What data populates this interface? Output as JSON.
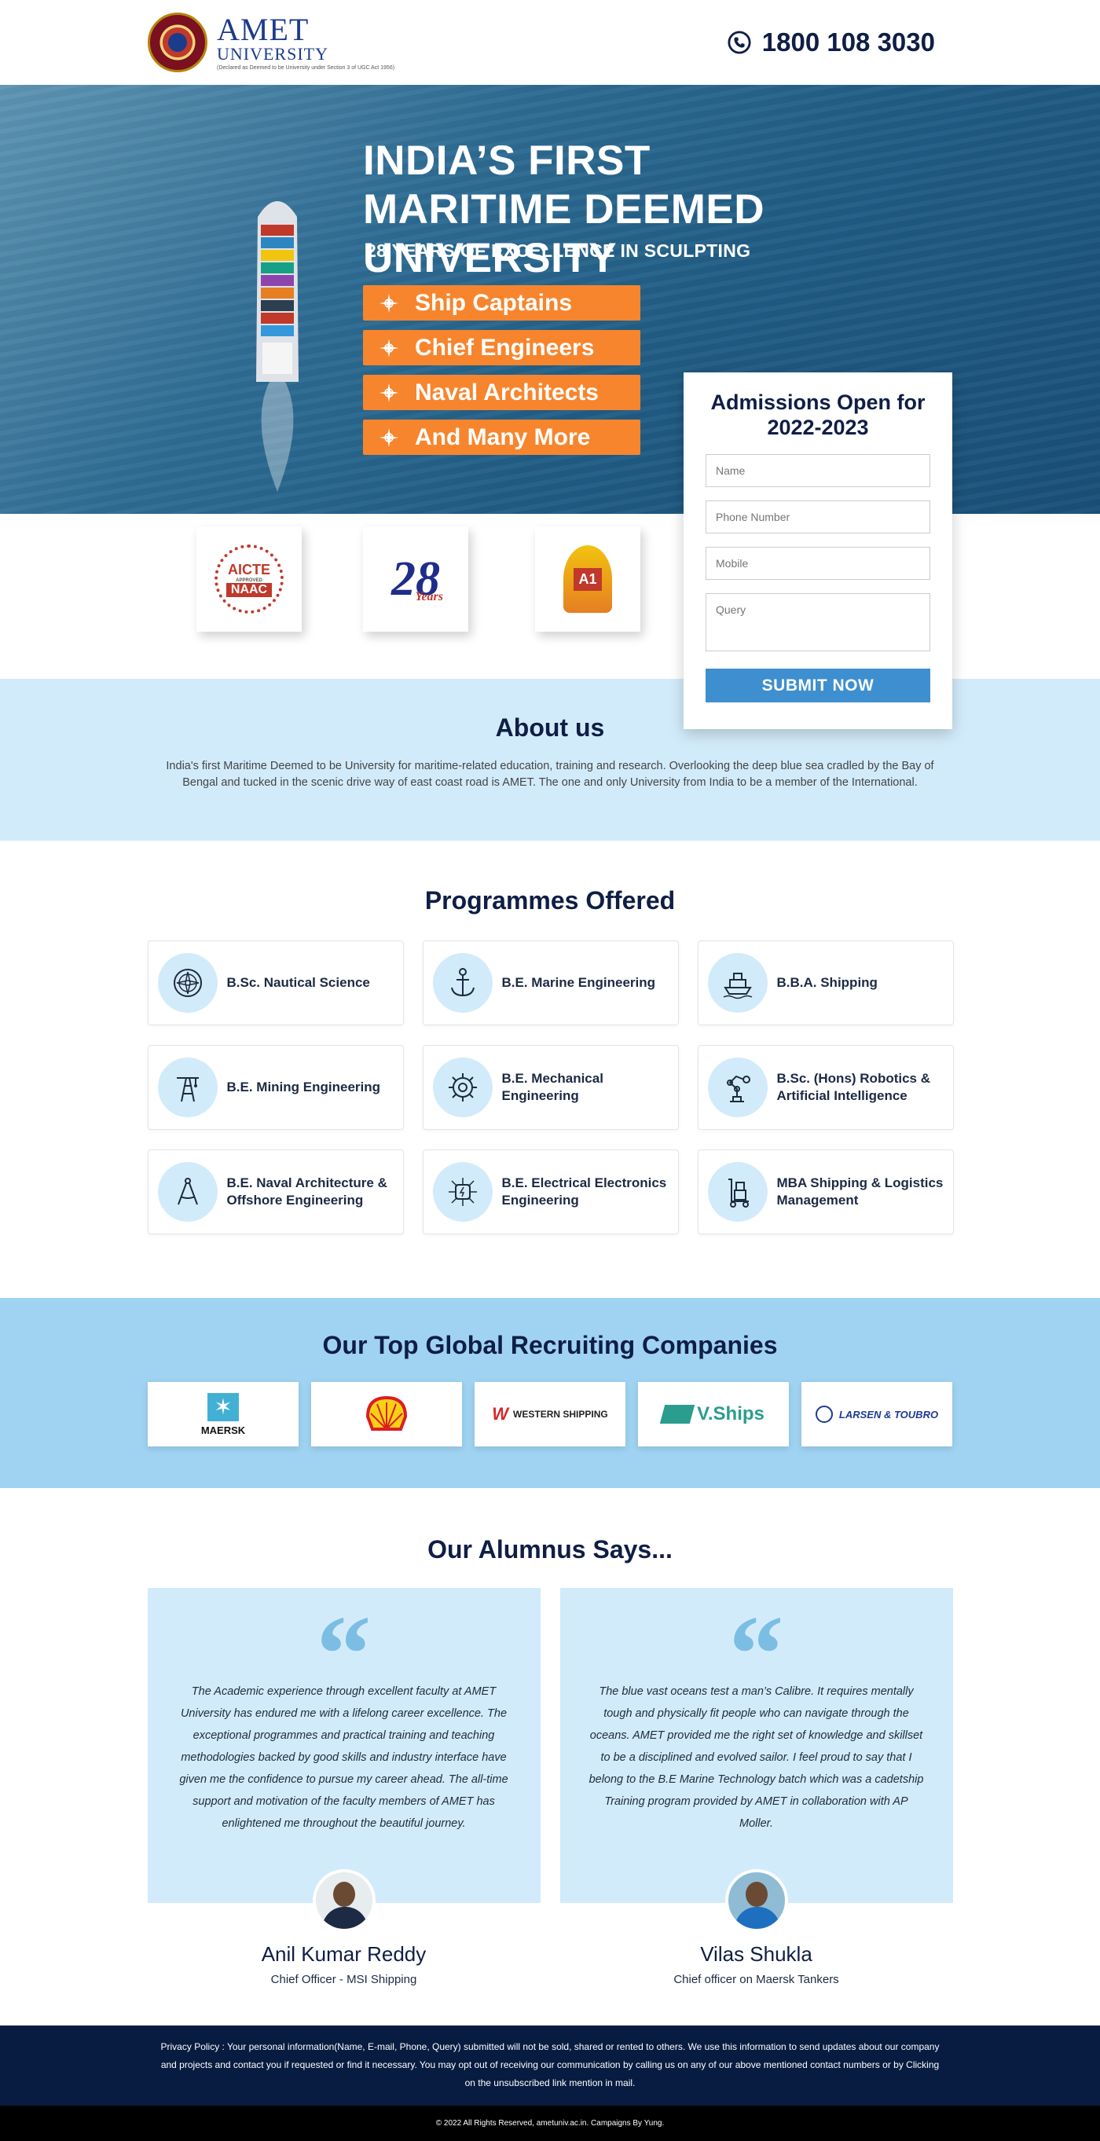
{
  "header": {
    "logo_name": "AMET",
    "logo_sub": "UNIVERSITY",
    "logo_tag": "(Declared as Deemed to be University under Section 3 of UGC Act 1956)",
    "phone": "1800 108 3030"
  },
  "hero": {
    "title": "INDIA’S FIRST MARITIME DEEMED UNIVERSITY",
    "subtitle": "28 YEARS OF EXCELLENCE IN SCULPTING",
    "pills": [
      "Ship Captains",
      "Chief Engineers",
      "Naval Architects",
      "And Many More"
    ]
  },
  "form": {
    "title": "Admissions Open for 2022-2023",
    "name_placeholder": "Name",
    "phone_placeholder": "Phone Number",
    "mobile_placeholder": "Mobile",
    "query_placeholder": "Query",
    "submit_label": "SUBMIT NOW"
  },
  "badges": {
    "aicte_top": "AICTE",
    "aicte_mid": "APPROVED",
    "aicte_bottom": "NAAC",
    "years_number": "28",
    "years_label": "Years",
    "a1_label": "A1"
  },
  "about": {
    "title": "About us",
    "text": "India's first Maritime Deemed to be University for maritime-related education, training and research. Overlooking the deep blue sea cradled by the Bay of Bengal and tucked in the scenic drive way of east coast road is AMET. The one and only University from India to be a member of the International."
  },
  "programmes": {
    "title": "Programmes Offered",
    "items": [
      {
        "label": "B.Sc. Nautical Science",
        "icon": "compass-icon"
      },
      {
        "label": "B.E. Marine Engineering",
        "icon": "anchor-icon"
      },
      {
        "label": "B.B.A. Shipping",
        "icon": "ship-icon"
      },
      {
        "label": "B.E. Mining Engineering",
        "icon": "mining-rig-icon"
      },
      {
        "label": "B.E. Mechanical Engineering",
        "icon": "gear-wrench-icon"
      },
      {
        "label": "B.Sc. (Hons) Robotics & Artificial Intelligence",
        "icon": "robot-arm-icon"
      },
      {
        "label": "B.E. Naval Architecture & Offshore Engineering",
        "icon": "drafting-compass-icon"
      },
      {
        "label": "B.E. Electrical Electronics Engineering",
        "icon": "circuit-icon"
      },
      {
        "label": "MBA Shipping & Logistics Management",
        "icon": "hand-truck-icon"
      }
    ]
  },
  "recruiters": {
    "title": "Our Top Global Recruiting Companies",
    "companies": [
      "MAERSK",
      "Shell",
      "WESTERN SHIPPING",
      "V.Ships",
      "LARSEN & TOUBRO"
    ]
  },
  "alumni": {
    "title": "Our Alumnus Says...",
    "testimonials": [
      {
        "text": "The Academic experience through excellent faculty at AMET University has endured me with a lifelong career excellence. The exceptional programmes and practical training and teaching methodologies backed by good skills and industry interface have given me the confidence to pursue my career ahead. The all-time support and motivation of the faculty members of AMET has enlightened me throughout the beautiful journey.",
        "name": "Anil Kumar Reddy",
        "role": "Chief Officer - MSI Shipping"
      },
      {
        "text": "The blue vast oceans test a man’s Calibre. It requires mentally tough and physically fit people who can navigate through the oceans. AMET provided me the right set of knowledge and skillset to be a disciplined and evolved sailor. I feel proud to say that I belong to the B.E Marine Technology batch which was a cadetship Training program provided by AMET in collaboration with AP Moller.",
        "name": "Vilas Shukla",
        "role": "Chief officer on Maersk Tankers"
      }
    ]
  },
  "footer": {
    "privacy": "Privacy Policy : Your personal information(Name, E-mail, Phone, Query) submitted will not be sold, shared or rented to others. We use this information to send updates about our company and projects and contact you if requested or find it necessary. You may opt out of receiving our communication by calling us on any of our above mentioned contact numbers or by Clicking on the unsubscribed link mention in mail.",
    "copyright": "© 2022 All Rights Reserved, ametuniv.ac.in. Campaigns By Yung."
  }
}
